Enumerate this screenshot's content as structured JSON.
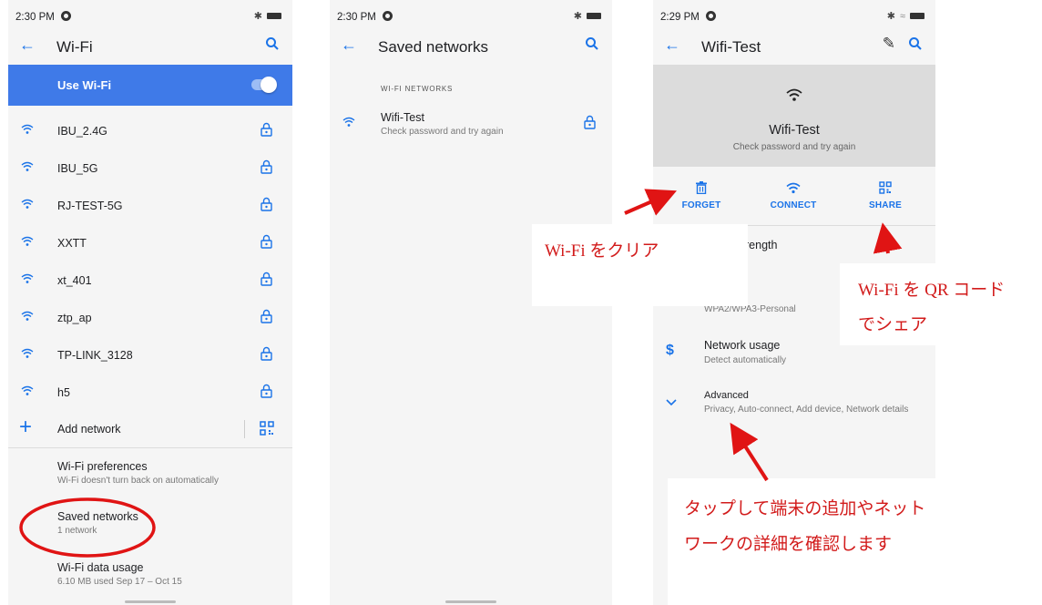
{
  "screen1": {
    "status": {
      "time": "2:30 PM"
    },
    "title": "Wi-Fi",
    "use_wifi": "Use Wi-Fi",
    "networks": [
      "IBU_2.4G",
      "IBU_5G",
      "RJ-TEST-5G",
      "XXTT",
      "xt_401",
      "ztp_ap",
      "TP-LINK_3128",
      "h5"
    ],
    "add_network": "Add network",
    "wifi_preferences": {
      "title": "Wi-Fi preferences",
      "subtitle": "Wi-Fi doesn't turn back on automatically"
    },
    "saved_networks": {
      "title": "Saved networks",
      "subtitle": "1 network"
    },
    "data_usage": {
      "title": "Wi-Fi data usage",
      "subtitle": "6.10 MB used Sep 17 – Oct 15"
    }
  },
  "screen2": {
    "status": {
      "time": "2:30 PM"
    },
    "title": "Saved networks",
    "section_label": "WI-FI NETWORKS",
    "network": {
      "name": "Wifi-Test",
      "status": "Check password and try again"
    }
  },
  "screen3": {
    "status": {
      "time": "2:29 PM"
    },
    "title": "Wifi-Test",
    "header": {
      "name": "Wifi-Test",
      "status": "Check password and try again"
    },
    "actions": {
      "forget": "FORGET",
      "connect": "CONNECT",
      "share": "SHARE"
    },
    "signal_partial": "rength",
    "security_value": "WPA2/WPA3-Personal",
    "network_usage": {
      "title": "Network usage",
      "subtitle": "Detect automatically"
    },
    "advanced": {
      "title": "Advanced",
      "subtitle": "Privacy, Auto-connect, Add device, Network details"
    }
  },
  "annotations": {
    "clear": "Wi-Fi をクリア",
    "share_line1": "Wi-Fi を QR コード",
    "share_line2": "でシェア",
    "details_line1": "タップして端末の追加やネット",
    "details_line2": "ワークの詳細を確認します"
  },
  "colors": {
    "accent": "#1a73e8",
    "toggle_bar": "#3f7ae8",
    "annotation": "#d21b1b"
  }
}
